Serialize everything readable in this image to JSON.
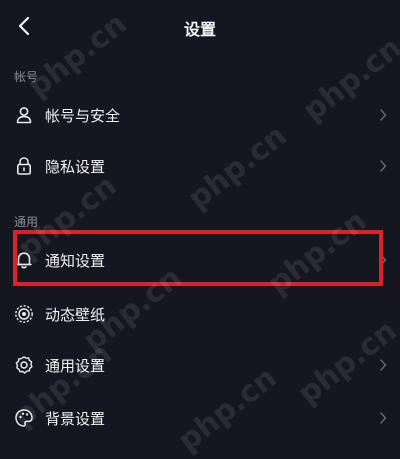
{
  "header": {
    "title": "设置",
    "back_icon": "chevron-left-icon"
  },
  "sections": {
    "account": "帐号",
    "general": "通用"
  },
  "items": [
    {
      "label": "帐号与安全",
      "icon": "user-icon"
    },
    {
      "label": "隐私设置",
      "icon": "lock-icon"
    },
    {
      "label": "通知设置",
      "icon": "bell-icon"
    },
    {
      "label": "动态壁纸",
      "icon": "wallpaper-icon"
    },
    {
      "label": "通用设置",
      "icon": "gear-icon"
    },
    {
      "label": "背景设置",
      "icon": "palette-icon"
    }
  ],
  "watermark": "php.cn",
  "colors": {
    "background": "#161620",
    "highlight": "#d8232a",
    "text": "#f1f1f3",
    "muted": "#8a8a94"
  }
}
